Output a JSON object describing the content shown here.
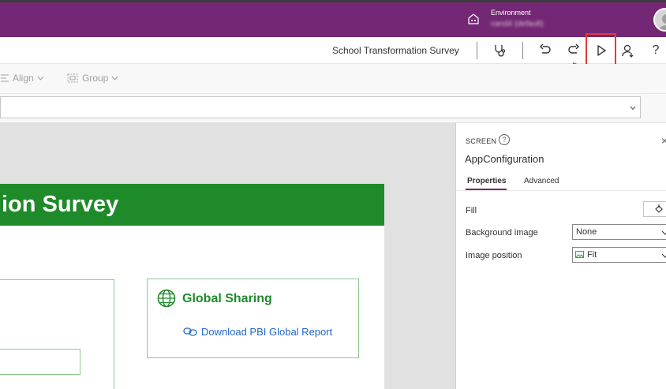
{
  "header": {
    "environment_label": "Environment",
    "environment_value": "cand4 (default)"
  },
  "command_bar": {
    "app_title": "School Transformation Survey",
    "icons": [
      "stethoscope-icon",
      "undo-icon",
      "redo-icon",
      "play-icon",
      "share-user-icon",
      "help-icon"
    ],
    "help_glyph": "?"
  },
  "ribbon": {
    "align_label": "Align",
    "group_label": "Group"
  },
  "canvas": {
    "screen_title": "ion Survey",
    "global_card": {
      "title": "Global Sharing",
      "link_text": "Download PBI Global Report"
    }
  },
  "properties_pane": {
    "type_label": "SCREEN",
    "help_glyph": "?",
    "close_glyph": "×",
    "screen_name": "AppConfiguration",
    "tabs": [
      {
        "label": "Properties",
        "active": true
      },
      {
        "label": "Advanced",
        "active": false
      }
    ],
    "fill_label": "Fill",
    "background_image_label": "Background image",
    "background_image_value": "None",
    "image_position_label": "Image position",
    "image_position_value": "Fit"
  },
  "colors": {
    "brand_purple": "#742774",
    "header_green": "#1f8a2a",
    "link_blue": "#2266cc",
    "annotation_red": "#e53935"
  }
}
